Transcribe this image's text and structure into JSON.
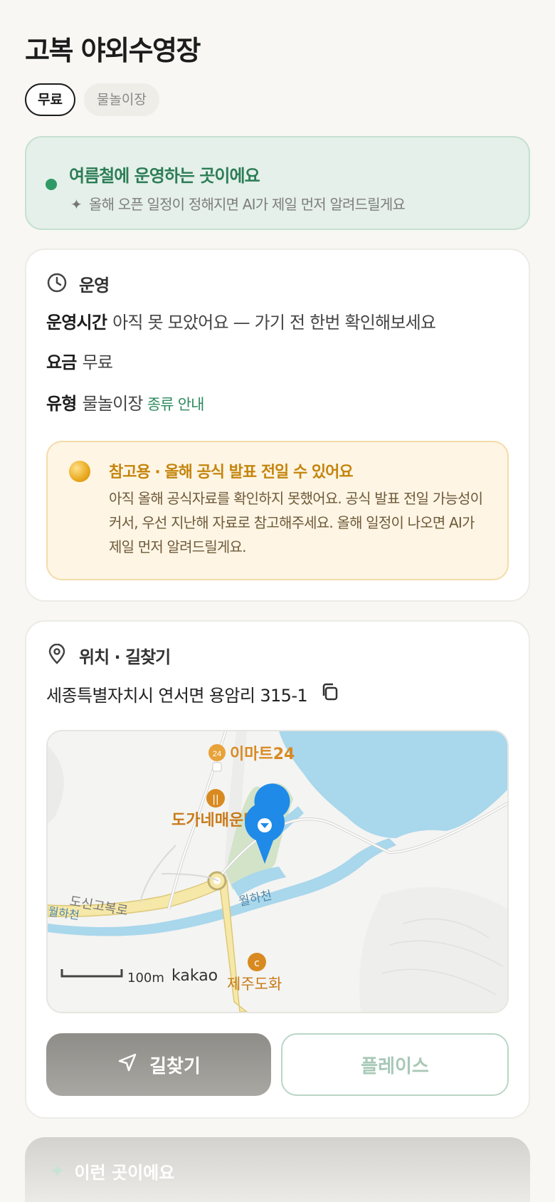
{
  "header": {
    "title": "고복 야외수영장",
    "tags": [
      "무료",
      "물놀이장"
    ]
  },
  "notice": {
    "title": "여름철에 운영하는 곳이에요",
    "subtitle": "올해 오픈 일정이 정해지면 AI가 제일 먼저 알려드릴게요",
    "accent": "#2f9a66"
  },
  "operation": {
    "heading": "운영",
    "hours_label": "운영시간",
    "hours_value": "아직 못 모았어요 — 가기 전 한번 확인해보세요",
    "fee_label": "요금",
    "fee_value": "무료",
    "type_label": "유형",
    "type_value": "물놀이장",
    "type_link": "종류 안내",
    "warning": {
      "title": "참고용 · 올해 공식 발표 전일 수 있어요",
      "body": "아직 올해 공식자료를 확인하지 못했어요. 공식 발표 전일 가능성이 커서, 우선 지난해 자료로 참고해주세요. 올해 일정이 나오면 AI가 제일 먼저 알려드릴게요."
    }
  },
  "location": {
    "heading": "위치 · 길찾기",
    "address": "세종특별자치시 연서면 용암리 315-1",
    "map": {
      "labels": {
        "emart": "이마트24",
        "restaurant": "도가네매운탕",
        "cafe": "제주도화",
        "stream1": "월하천",
        "stream2": "월하천",
        "road": "도신고복로",
        "scale": "100m",
        "brand": "kakao"
      }
    },
    "nav_button": "길찾기",
    "place_button": "플레이스"
  },
  "next_section": {
    "heading": "이런 곳이에요"
  }
}
